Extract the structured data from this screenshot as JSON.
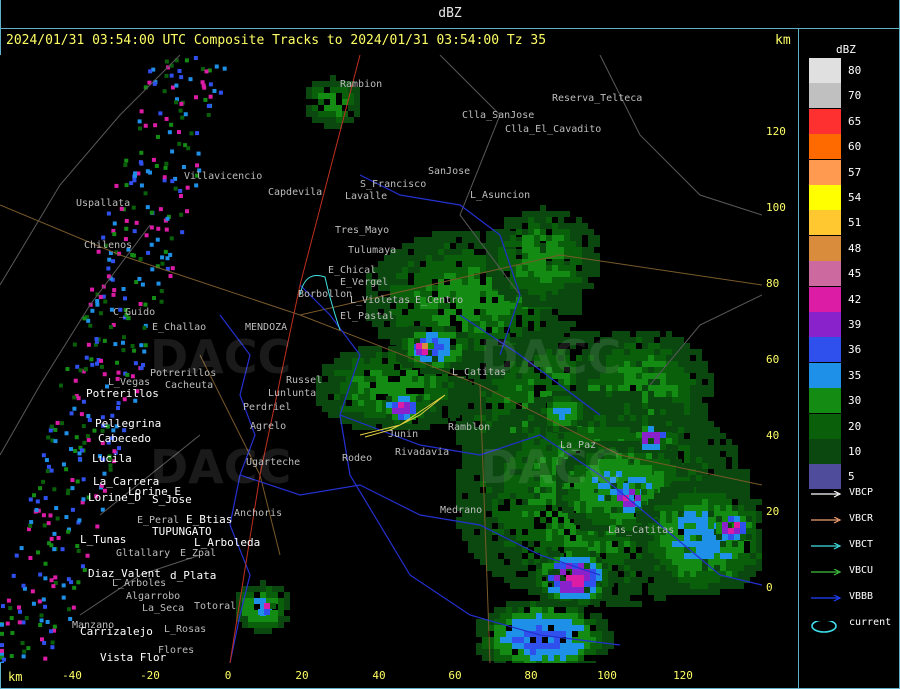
{
  "window": {
    "title": "dBZ"
  },
  "header": {
    "text": "2024/01/31 03:54:00 UTC Composite Tracks to 2024/01/31 03:54:00 Tz 35",
    "km_top": "km",
    "km_bottom": "km"
  },
  "axes": {
    "x_ticks": [
      "-40",
      "-20",
      "0",
      "20",
      "40",
      "60",
      "80",
      "100",
      "120"
    ],
    "y_ticks": [
      "120",
      "100",
      "80",
      "60",
      "40",
      "20",
      "0"
    ]
  },
  "legend": {
    "title": "dBZ",
    "scale": [
      {
        "label": "80",
        "color": "#e0e0e0"
      },
      {
        "label": "70",
        "color": "#c0c0c0"
      },
      {
        "label": "65",
        "color": "#ff3030"
      },
      {
        "label": "60",
        "color": "#ff6a00"
      },
      {
        "label": "57",
        "color": "#ff9a50"
      },
      {
        "label": "54",
        "color": "#ffff00"
      },
      {
        "label": "51",
        "color": "#ffc830"
      },
      {
        "label": "48",
        "color": "#d88c3c"
      },
      {
        "label": "45",
        "color": "#cc6aa0"
      },
      {
        "label": "42",
        "color": "#dd1ca6"
      },
      {
        "label": "39",
        "color": "#8a22cc"
      },
      {
        "label": "36",
        "color": "#3050ee"
      },
      {
        "label": "35",
        "color": "#1e90e8"
      },
      {
        "label": "30",
        "color": "#148c14"
      },
      {
        "label": "20",
        "color": "#0a5f0a"
      },
      {
        "label": "10",
        "color": "#0a4810"
      },
      {
        "label": "5",
        "color": "#504c9c"
      }
    ],
    "tracks": [
      {
        "label": "VBCP",
        "color": "#ffffff"
      },
      {
        "label": "VBCR",
        "color": "#f0a070"
      },
      {
        "label": "VBCT",
        "color": "#40e0e0"
      },
      {
        "label": "VBCU",
        "color": "#40c040"
      },
      {
        "label": "VBBB",
        "color": "#2040ff"
      },
      {
        "label": "current",
        "color": "#40e0f0"
      }
    ]
  },
  "places_dim": [
    "Rambion",
    "Reserva_Telteca",
    "Clla_SanJose",
    "Clla_El_Cavadito",
    "SanJose",
    "S_Francisco",
    "Uspallata",
    "Villavicencio",
    "Capdevila",
    "L_Asuncion",
    "Lavalle",
    "Tres_Mayo",
    "Tulumaya",
    "E_Chical",
    "E_Vergel",
    "Borbollon",
    "L_Violetas",
    "E_Centro",
    "C_Guido",
    "E_Challao",
    "MENDOZA",
    "El_Pastal",
    "Lunlunta",
    "Perdriel",
    "Agrelo",
    "Ugarteche",
    "Russel",
    "Rodeo",
    "Junin",
    "Rivadavia",
    "La_Paz",
    "L_Catitas",
    "Chilenos",
    "L_Vegas",
    "Potrerillos",
    "Cacheuta",
    "E_Peral",
    "Anchoris",
    "Gltallary",
    "E_Zpal",
    "L_Arboles",
    "Algarrobo",
    "La_Seca",
    "Totoral",
    "L_Rosas",
    "Flores",
    "Manzano",
    "Medrano",
    "Ramblon",
    "Las_Catitas"
  ],
  "places_bright": [
    "Potrerillos",
    "Pellegrina",
    "Cabecedo",
    "Lucila",
    "La_Carrera",
    "Lorine_D",
    "Lorine_E",
    "S_Jose",
    "L_Tunas",
    "Diaz_Valent",
    "TUPUNGATO",
    "Carrizalejo",
    "Vista_Flor",
    "E_Btias",
    "L_Arboleda",
    "d_Plata"
  ],
  "watermark": "DACC"
}
